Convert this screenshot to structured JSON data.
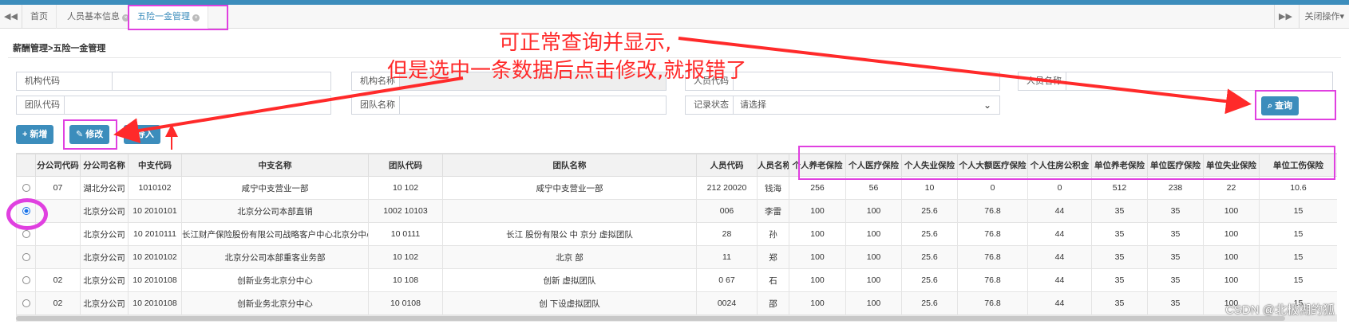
{
  "tabs": {
    "prev_icon": "double-left-icon",
    "items": [
      {
        "label": "首页"
      },
      {
        "label": "人员基本信息"
      },
      {
        "label": "五险一金管理"
      }
    ],
    "next_icon": "double-right-icon",
    "close_ops": "关闭操作"
  },
  "breadcrumb": "薪酬管理>五险一金管理",
  "search": {
    "org_code_label": "机构代码",
    "org_name_label": "机构名称",
    "person_code_label": "人员代码",
    "person_name_label": "人员名称",
    "team_code_label": "团队代码",
    "team_name_label": "团队名称",
    "status_label": "记录状态",
    "status_value": "请选择",
    "query_button": "查询"
  },
  "toolbar": {
    "add_label": "新增",
    "edit_label": "修改",
    "import_label": "导入"
  },
  "annotation": {
    "line1": "可正常查询并显示,",
    "line2": "但是选中一条数据后点击修改,就报错了"
  },
  "table": {
    "columns": [
      "",
      "分公司代码",
      "分公司名称",
      "中支代码",
      "中支名称",
      "团队代码",
      "团队名称",
      "人员代码",
      "人员名称",
      "个人养老保险",
      "个人医疗保险",
      "个人失业保险",
      "个人大额医疗保险",
      "个人住房公积金",
      "单位养老保险",
      "单位医疗保险",
      "单位失业保险",
      "单位工伤保险"
    ],
    "rows": [
      {
        "selected": false,
        "cells": [
          "07",
          "湖北分公司",
          "1010102",
          "咸宁中支营业一部",
          "10  102",
          "咸宁中支营业一部",
          "212  20020",
          "钱海",
          "256",
          "56",
          "10",
          "0",
          "0",
          "512",
          "238",
          "22",
          "10.6"
        ]
      },
      {
        "selected": true,
        "cells": [
          "",
          "北京分公司",
          "10  2010101",
          "北京分公司本部直销",
          "1002  10103",
          "",
          "  006",
          "李雷",
          "100",
          "100",
          "25.6",
          "76.8",
          "44",
          "35",
          "35",
          "100",
          "15"
        ]
      },
      {
        "selected": false,
        "cells": [
          "",
          "北京分公司",
          "10  2010111",
          "长江财产保险股份有限公司战略客户中心北京分中心",
          "10  0111",
          "长江  股份有限公  中  京分  虚拟团队",
          "  28",
          "孙",
          "100",
          "100",
          "25.6",
          "76.8",
          "44",
          "35",
          "35",
          "100",
          "15"
        ]
      },
      {
        "selected": false,
        "cells": [
          "",
          "北京分公司",
          "10  2010102",
          "北京分公司本部重客业务部",
          "10  102",
          "北京  部",
          "  11",
          "郑",
          "100",
          "100",
          "25.6",
          "76.8",
          "44",
          "35",
          "35",
          "100",
          "15"
        ]
      },
      {
        "selected": false,
        "cells": [
          "02",
          "北京分公司",
          "10  2010108",
          "创新业务北京分中心",
          "10  108",
          "创新  虚拟团队",
          "  0  67",
          "石",
          "100",
          "100",
          "25.6",
          "76.8",
          "44",
          "35",
          "35",
          "100",
          "15"
        ]
      },
      {
        "selected": false,
        "cells": [
          "02",
          "北京分公司",
          "10  2010108",
          "创新业务北京分中心",
          "10  0108",
          "创  下设虚拟团队",
          "  0024",
          "邵",
          "100",
          "100",
          "25.6",
          "76.8",
          "44",
          "35",
          "35",
          "100",
          "15"
        ]
      }
    ]
  },
  "watermark": "CSDN @北极糊的狐"
}
